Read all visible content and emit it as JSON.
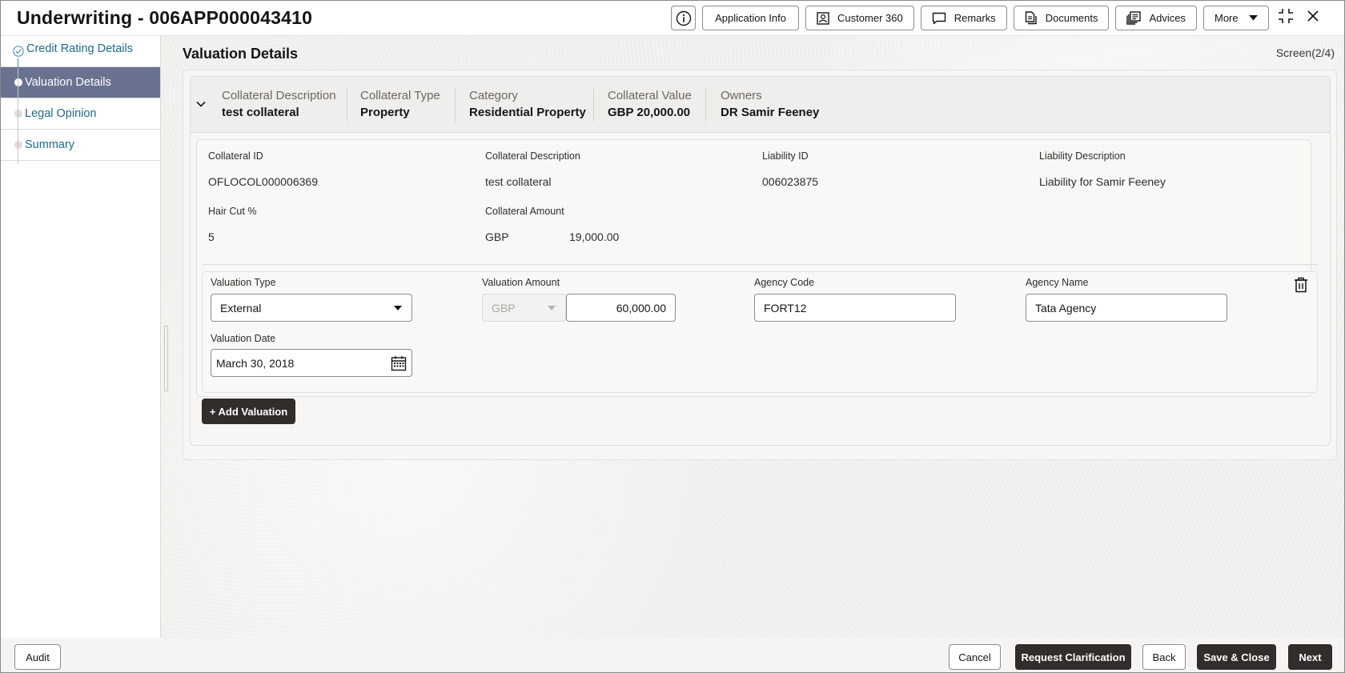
{
  "header": {
    "title": "Underwriting - 006APP000043410",
    "buttons": {
      "info_icon": "info-icon",
      "application_info": "Application Info",
      "customer_360": "Customer 360",
      "remarks": "Remarks",
      "documents": "Documents",
      "advices": "Advices",
      "more": "More"
    }
  },
  "sidebar": {
    "steps": [
      {
        "label": "Credit Rating Details",
        "state": "completed"
      },
      {
        "label": "Valuation Details",
        "state": "active"
      },
      {
        "label": "Legal Opinion",
        "state": "pending"
      },
      {
        "label": "Summary",
        "state": "pending"
      }
    ]
  },
  "main": {
    "page_title": "Valuation Details",
    "screen_indicator": "Screen(2/4)",
    "collateral_summary": [
      {
        "label": "Collateral Description",
        "value": "test collateral"
      },
      {
        "label": "Collateral Type",
        "value": "Property"
      },
      {
        "label": "Category",
        "value": "Residential Property"
      },
      {
        "label": "Collateral Value",
        "value": "GBP 20,000.00"
      },
      {
        "label": "Owners",
        "value": "DR Samir Feeney"
      }
    ],
    "collateral_details": {
      "collateral_id": {
        "label": "Collateral ID",
        "value": "OFLOCOL000006369"
      },
      "collateral_description": {
        "label": "Collateral Description",
        "value": "test collateral"
      },
      "liability_id": {
        "label": "Liability ID",
        "value": "006023875"
      },
      "liability_description": {
        "label": "Liability Description",
        "value": "Liability for Samir Feeney"
      },
      "hair_cut": {
        "label": "Hair Cut %",
        "value": "5"
      },
      "collateral_amount": {
        "label": "Collateral Amount",
        "currency": "GBP",
        "value": "19,000.00"
      }
    },
    "valuation": {
      "valuation_type": {
        "label": "Valuation Type",
        "value": "External"
      },
      "valuation_amount": {
        "label": "Valuation Amount",
        "currency": "GBP",
        "value": "60,000.00"
      },
      "agency_code": {
        "label": "Agency Code",
        "value": "FORT12"
      },
      "agency_name": {
        "label": "Agency Name",
        "value": "Tata Agency"
      },
      "valuation_date": {
        "label": "Valuation Date",
        "value": "March 30, 2018"
      }
    },
    "add_valuation_label": "+ Add Valuation"
  },
  "footer": {
    "audit": "Audit",
    "cancel": "Cancel",
    "request_clarification": "Request Clarification",
    "back": "Back",
    "save_close": "Save & Close",
    "next": "Next"
  }
}
